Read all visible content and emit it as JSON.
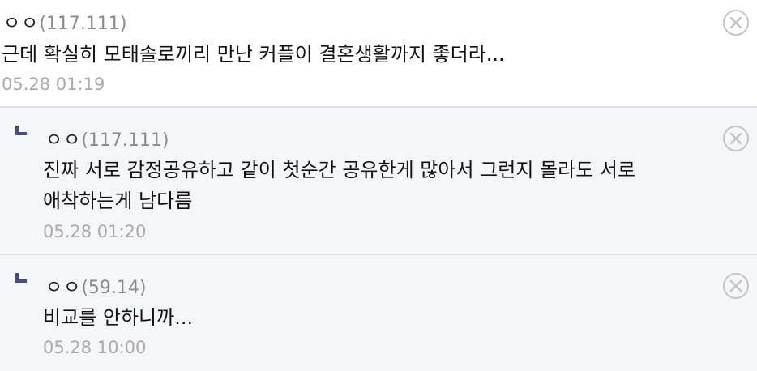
{
  "comments": [
    {
      "author": "ㅇㅇ",
      "ip": "(117.111)",
      "lines": [
        "근데 확실히 모태솔로끼리 만난 커플이 결혼생활까지 좋더라..."
      ],
      "date": "05.28 01:19",
      "is_reply": false
    },
    {
      "author": "ㅇㅇ",
      "ip": "(117.111)",
      "lines": [
        "진짜 서로 감정공유하고 같이 첫순간 공유한게 많아서 그런지 몰라도 서로",
        "애착하는게 남다름"
      ],
      "date": "05.28 01:20",
      "is_reply": true
    },
    {
      "author": "ㅇㅇ",
      "ip": "(59.14)",
      "lines": [
        "비교를 안하니까..."
      ],
      "date": "05.28 10:00",
      "is_reply": true
    }
  ],
  "icons": {
    "delete": "close-circle-icon",
    "reply": "reply-arrow-icon"
  },
  "colors": {
    "reply_background": "#f5f6f9",
    "reply_marker": "#4b4d7c",
    "meta_text": "#a9a9ae",
    "ip_text": "#8a8a8a"
  }
}
